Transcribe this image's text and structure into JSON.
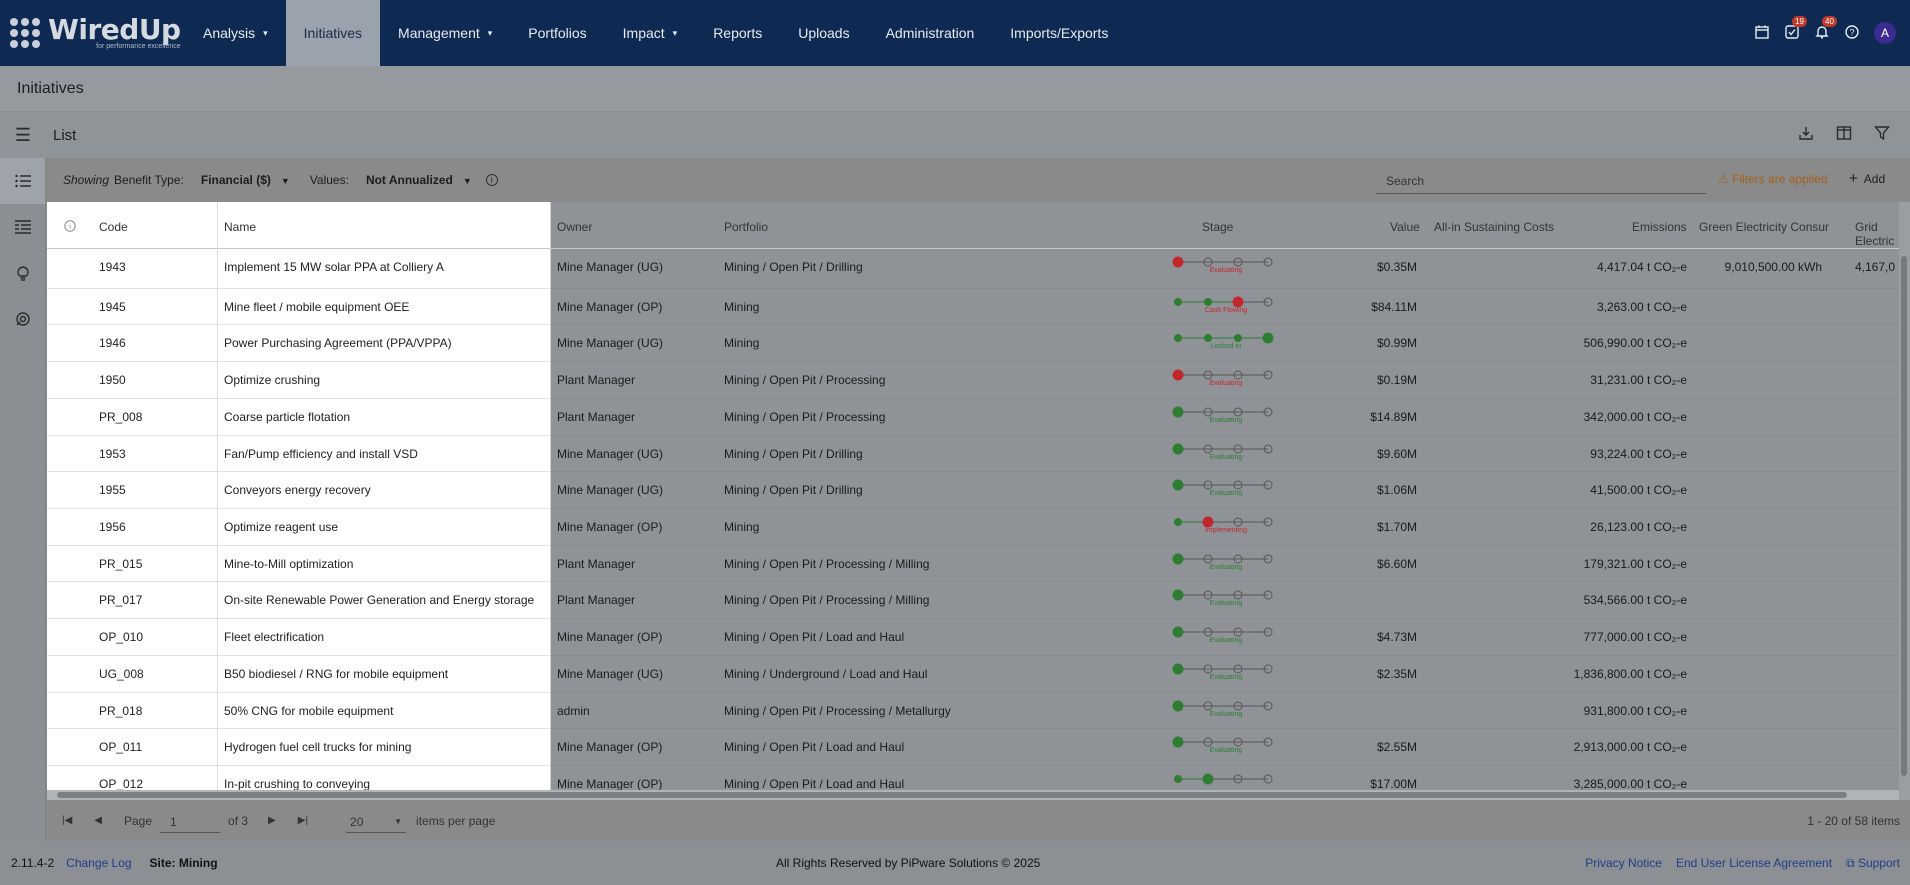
{
  "nav": {
    "logo_main": "WiredUp",
    "logo_sub": "for performance excellence",
    "items": [
      {
        "label": "Analysis",
        "dropdown": true
      },
      {
        "label": "Initiatives",
        "dropdown": false,
        "active": true
      },
      {
        "label": "Management",
        "dropdown": true
      },
      {
        "label": "Portfolios",
        "dropdown": false
      },
      {
        "label": "Impact",
        "dropdown": true
      },
      {
        "label": "Reports",
        "dropdown": false
      },
      {
        "label": "Uploads",
        "dropdown": false
      },
      {
        "label": "Administration",
        "dropdown": false
      },
      {
        "label": "Imports/Exports",
        "dropdown": false
      }
    ],
    "caret": "▾",
    "tasks_badge": "19",
    "notifications_badge": "40",
    "avatar": "A"
  },
  "page": {
    "title": "Initiatives",
    "list_title": "List"
  },
  "filters": {
    "showing": "Showing",
    "benefit_type_label": "Benefit Type:",
    "benefit_type_value": "Financial ($)",
    "values_label": "Values:",
    "values_value": "Not Annualized",
    "search_placeholder": "Search",
    "filters_applied": "Filters are applied",
    "add_label": "Add"
  },
  "columns": {
    "code": "Code",
    "name": "Name",
    "owner": "Owner",
    "portfolio": "Portfolio",
    "stage": "Stage",
    "value": "Value",
    "sustaining": "All-in Sustaining Costs",
    "emissions": "Emissions",
    "green": "Green Electricity Consur",
    "grid": "Grid Electric"
  },
  "rows": [
    {
      "code": "1943",
      "name": "Implement 15 MW solar PPA at Colliery A",
      "owner": "Mine Manager (UG)",
      "portfolio": "Mining / Open Pit / Drilling",
      "stage_label": "Evaluating",
      "stage_index": 0,
      "stage_color": "red",
      "value": "$0.35M",
      "emissions": "4,417.04 t CO₂-e",
      "green": "9,010,500.00 kWh",
      "grid": "4,167,0"
    },
    {
      "code": "1945",
      "name": "Mine fleet / mobile equipment OEE",
      "owner": "Mine Manager (OP)",
      "portfolio": "Mining",
      "stage_label": "Cash Flowing",
      "stage_index": 2,
      "stage_color": "red",
      "value": "$84.11M",
      "emissions": "3,263.00 t CO₂-e",
      "green": "",
      "grid": ""
    },
    {
      "code": "1946",
      "name": "Power Purchasing Agreement (PPA/VPPA)",
      "owner": "Mine Manager (UG)",
      "portfolio": "Mining",
      "stage_label": "Locked-in",
      "stage_index": 3,
      "stage_color": "green",
      "value": "$0.99M",
      "emissions": "506,990.00 t CO₂-e",
      "green": "",
      "grid": ""
    },
    {
      "code": "1950",
      "name": "Optimize crushing",
      "owner": "Plant Manager",
      "portfolio": "Mining / Open Pit / Processing",
      "stage_label": "Evaluating",
      "stage_index": 0,
      "stage_color": "red",
      "value": "$0.19M",
      "emissions": "31,231.00 t CO₂-e",
      "green": "",
      "grid": ""
    },
    {
      "code": "PR_008",
      "name": "Coarse particle flotation",
      "owner": "Plant Manager",
      "portfolio": "Mining / Open Pit / Processing",
      "stage_label": "Evaluating",
      "stage_index": 0,
      "stage_color": "green",
      "value": "$14.89M",
      "emissions": "342,000.00 t CO₂-e",
      "green": "",
      "grid": ""
    },
    {
      "code": "1953",
      "name": "Fan/Pump efficiency and install VSD",
      "owner": "Mine Manager (UG)",
      "portfolio": "Mining / Open Pit / Drilling",
      "stage_label": "Evaluating",
      "stage_index": 0,
      "stage_color": "green",
      "value": "$9.60M",
      "emissions": "93,224.00 t CO₂-e",
      "green": "",
      "grid": ""
    },
    {
      "code": "1955",
      "name": "Conveyors energy recovery",
      "owner": "Mine Manager (UG)",
      "portfolio": "Mining / Open Pit / Drilling",
      "stage_label": "Evaluating",
      "stage_index": 0,
      "stage_color": "green",
      "value": "$1.06M",
      "emissions": "41,500.00 t CO₂-e",
      "green": "",
      "grid": ""
    },
    {
      "code": "1956",
      "name": "Optimize reagent use",
      "owner": "Mine Manager (OP)",
      "portfolio": "Mining",
      "stage_label": "Implementing",
      "stage_index": 1,
      "stage_color": "red",
      "value": "$1.70M",
      "emissions": "26,123.00 t CO₂-e",
      "green": "",
      "grid": ""
    },
    {
      "code": "PR_015",
      "name": "Mine-to-Mill optimization",
      "owner": "Plant Manager",
      "portfolio": "Mining / Open Pit / Processing / Milling",
      "stage_label": "Evaluating",
      "stage_index": 0,
      "stage_color": "green",
      "value": "$6.60M",
      "emissions": "179,321.00 t CO₂-e",
      "green": "",
      "grid": ""
    },
    {
      "code": "PR_017",
      "name": "On-site Renewable Power Generation and Energy storage",
      "owner": "Plant Manager",
      "portfolio": "Mining / Open Pit / Processing / Milling",
      "stage_label": "Evaluating",
      "stage_index": 0,
      "stage_color": "green",
      "value": "",
      "emissions": "534,566.00 t CO₂-e",
      "green": "",
      "grid": ""
    },
    {
      "code": "OP_010",
      "name": "Fleet electrification",
      "owner": "Mine Manager (OP)",
      "portfolio": "Mining / Open Pit / Load and Haul",
      "stage_label": "Evaluating",
      "stage_index": 0,
      "stage_color": "green",
      "value": "$4.73M",
      "emissions": "777,000.00 t CO₂-e",
      "green": "",
      "grid": ""
    },
    {
      "code": "UG_008",
      "name": "B50 biodiesel / RNG for mobile equipment",
      "owner": "Mine Manager (UG)",
      "portfolio": "Mining / Underground / Load and Haul",
      "stage_label": "Evaluating",
      "stage_index": 0,
      "stage_color": "green",
      "value": "$2.35M",
      "emissions": "1,836,800.00 t CO₂-e",
      "green": "",
      "grid": ""
    },
    {
      "code": "PR_018",
      "name": "50% CNG for mobile equipment",
      "owner": "admin",
      "portfolio": "Mining / Open Pit / Processing / Metallurgy",
      "stage_label": "Evaluating",
      "stage_index": 0,
      "stage_color": "green",
      "value": "",
      "emissions": "931,800.00 t CO₂-e",
      "green": "",
      "grid": ""
    },
    {
      "code": "OP_011",
      "name": "Hydrogen fuel cell trucks for mining",
      "owner": "Mine Manager (OP)",
      "portfolio": "Mining / Open Pit / Load and Haul",
      "stage_label": "Evaluating",
      "stage_index": 0,
      "stage_color": "green",
      "value": "$2.55M",
      "emissions": "2,913,000.00 t CO₂-e",
      "green": "",
      "grid": ""
    },
    {
      "code": "OP_012",
      "name": "In-pit crushing to conveying",
      "owner": "Mine Manager (OP)",
      "portfolio": "Mining / Open Pit / Load and Haul",
      "stage_label": "",
      "stage_index": 1,
      "stage_color": "green",
      "value": "$17.00M",
      "emissions": "3,285,000.00 t CO₂-e",
      "green": "",
      "grid": ""
    }
  ],
  "pager": {
    "page_label": "Page",
    "page_value": "1",
    "of_label": "of 3",
    "per_page": "20",
    "per_page_label": "items per page",
    "summary": "1 - 20 of 58 items"
  },
  "footer": {
    "version": "2.11.4-2",
    "changelog": "Change Log",
    "site": "Site: Mining",
    "copyright": "All Rights Reserved by PiPware Solutions © 2025",
    "privacy": "Privacy Notice",
    "eula": "End User License Agreement",
    "support": "Support"
  },
  "colors": {
    "navbar": "#0e2a52",
    "stage_red": "#c0282d",
    "stage_green": "#2e7d32",
    "warning": "#a3611a"
  }
}
